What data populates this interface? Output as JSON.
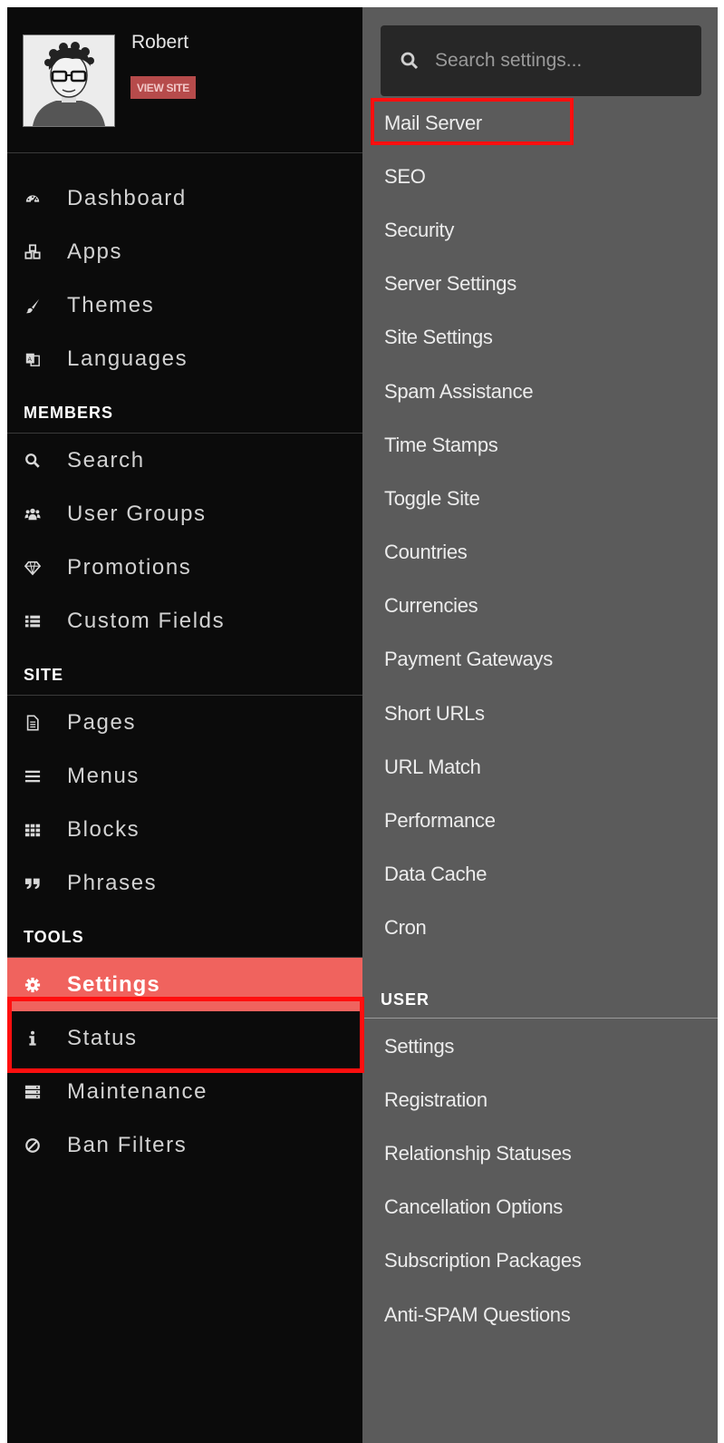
{
  "profile": {
    "name": "Robert",
    "view_site_label": "VIEW SITE"
  },
  "sidebar": {
    "main_items": [
      {
        "label": "Dashboard",
        "icon": "dashboard-icon"
      },
      {
        "label": "Apps",
        "icon": "cubes-icon"
      },
      {
        "label": "Themes",
        "icon": "paint-brush-icon"
      },
      {
        "label": "Languages",
        "icon": "language-icon"
      }
    ],
    "sections": [
      {
        "title": "MEMBERS",
        "items": [
          {
            "label": "Search",
            "icon": "search-icon"
          },
          {
            "label": "User Groups",
            "icon": "users-icon"
          },
          {
            "label": "Promotions",
            "icon": "diamond-icon"
          },
          {
            "label": "Custom Fields",
            "icon": "list-icon"
          }
        ]
      },
      {
        "title": "SITE",
        "items": [
          {
            "label": "Pages",
            "icon": "file-icon"
          },
          {
            "label": "Menus",
            "icon": "bars-icon"
          },
          {
            "label": "Blocks",
            "icon": "grid-icon"
          },
          {
            "label": "Phrases",
            "icon": "quote-icon"
          }
        ]
      },
      {
        "title": "TOOLS",
        "items": [
          {
            "label": "Settings",
            "icon": "gear-icon",
            "active": true
          },
          {
            "label": "Status",
            "icon": "info-icon"
          },
          {
            "label": "Maintenance",
            "icon": "server-icon"
          },
          {
            "label": "Ban Filters",
            "icon": "ban-icon"
          }
        ]
      }
    ]
  },
  "settings_panel": {
    "search_placeholder": "Search settings...",
    "site_items": [
      "Mail Server",
      "SEO",
      "Security",
      "Server Settings",
      "Site Settings",
      "Spam Assistance",
      "Time Stamps",
      "Toggle Site",
      "Countries",
      "Currencies",
      "Payment Gateways",
      "Short URLs",
      "URL Match",
      "Performance",
      "Data Cache",
      "Cron"
    ],
    "user_section_title": "USER",
    "user_items": [
      "Settings",
      "Registration",
      "Relationship Statuses",
      "Cancellation Options",
      "Subscription Packages",
      "Anti-SPAM Questions"
    ]
  },
  "colors": {
    "sidebar_bg": "#0b0b0b",
    "panel_bg": "#5b5b5b",
    "active_bg": "#f0635e",
    "annotation": "#ff0f0f"
  }
}
